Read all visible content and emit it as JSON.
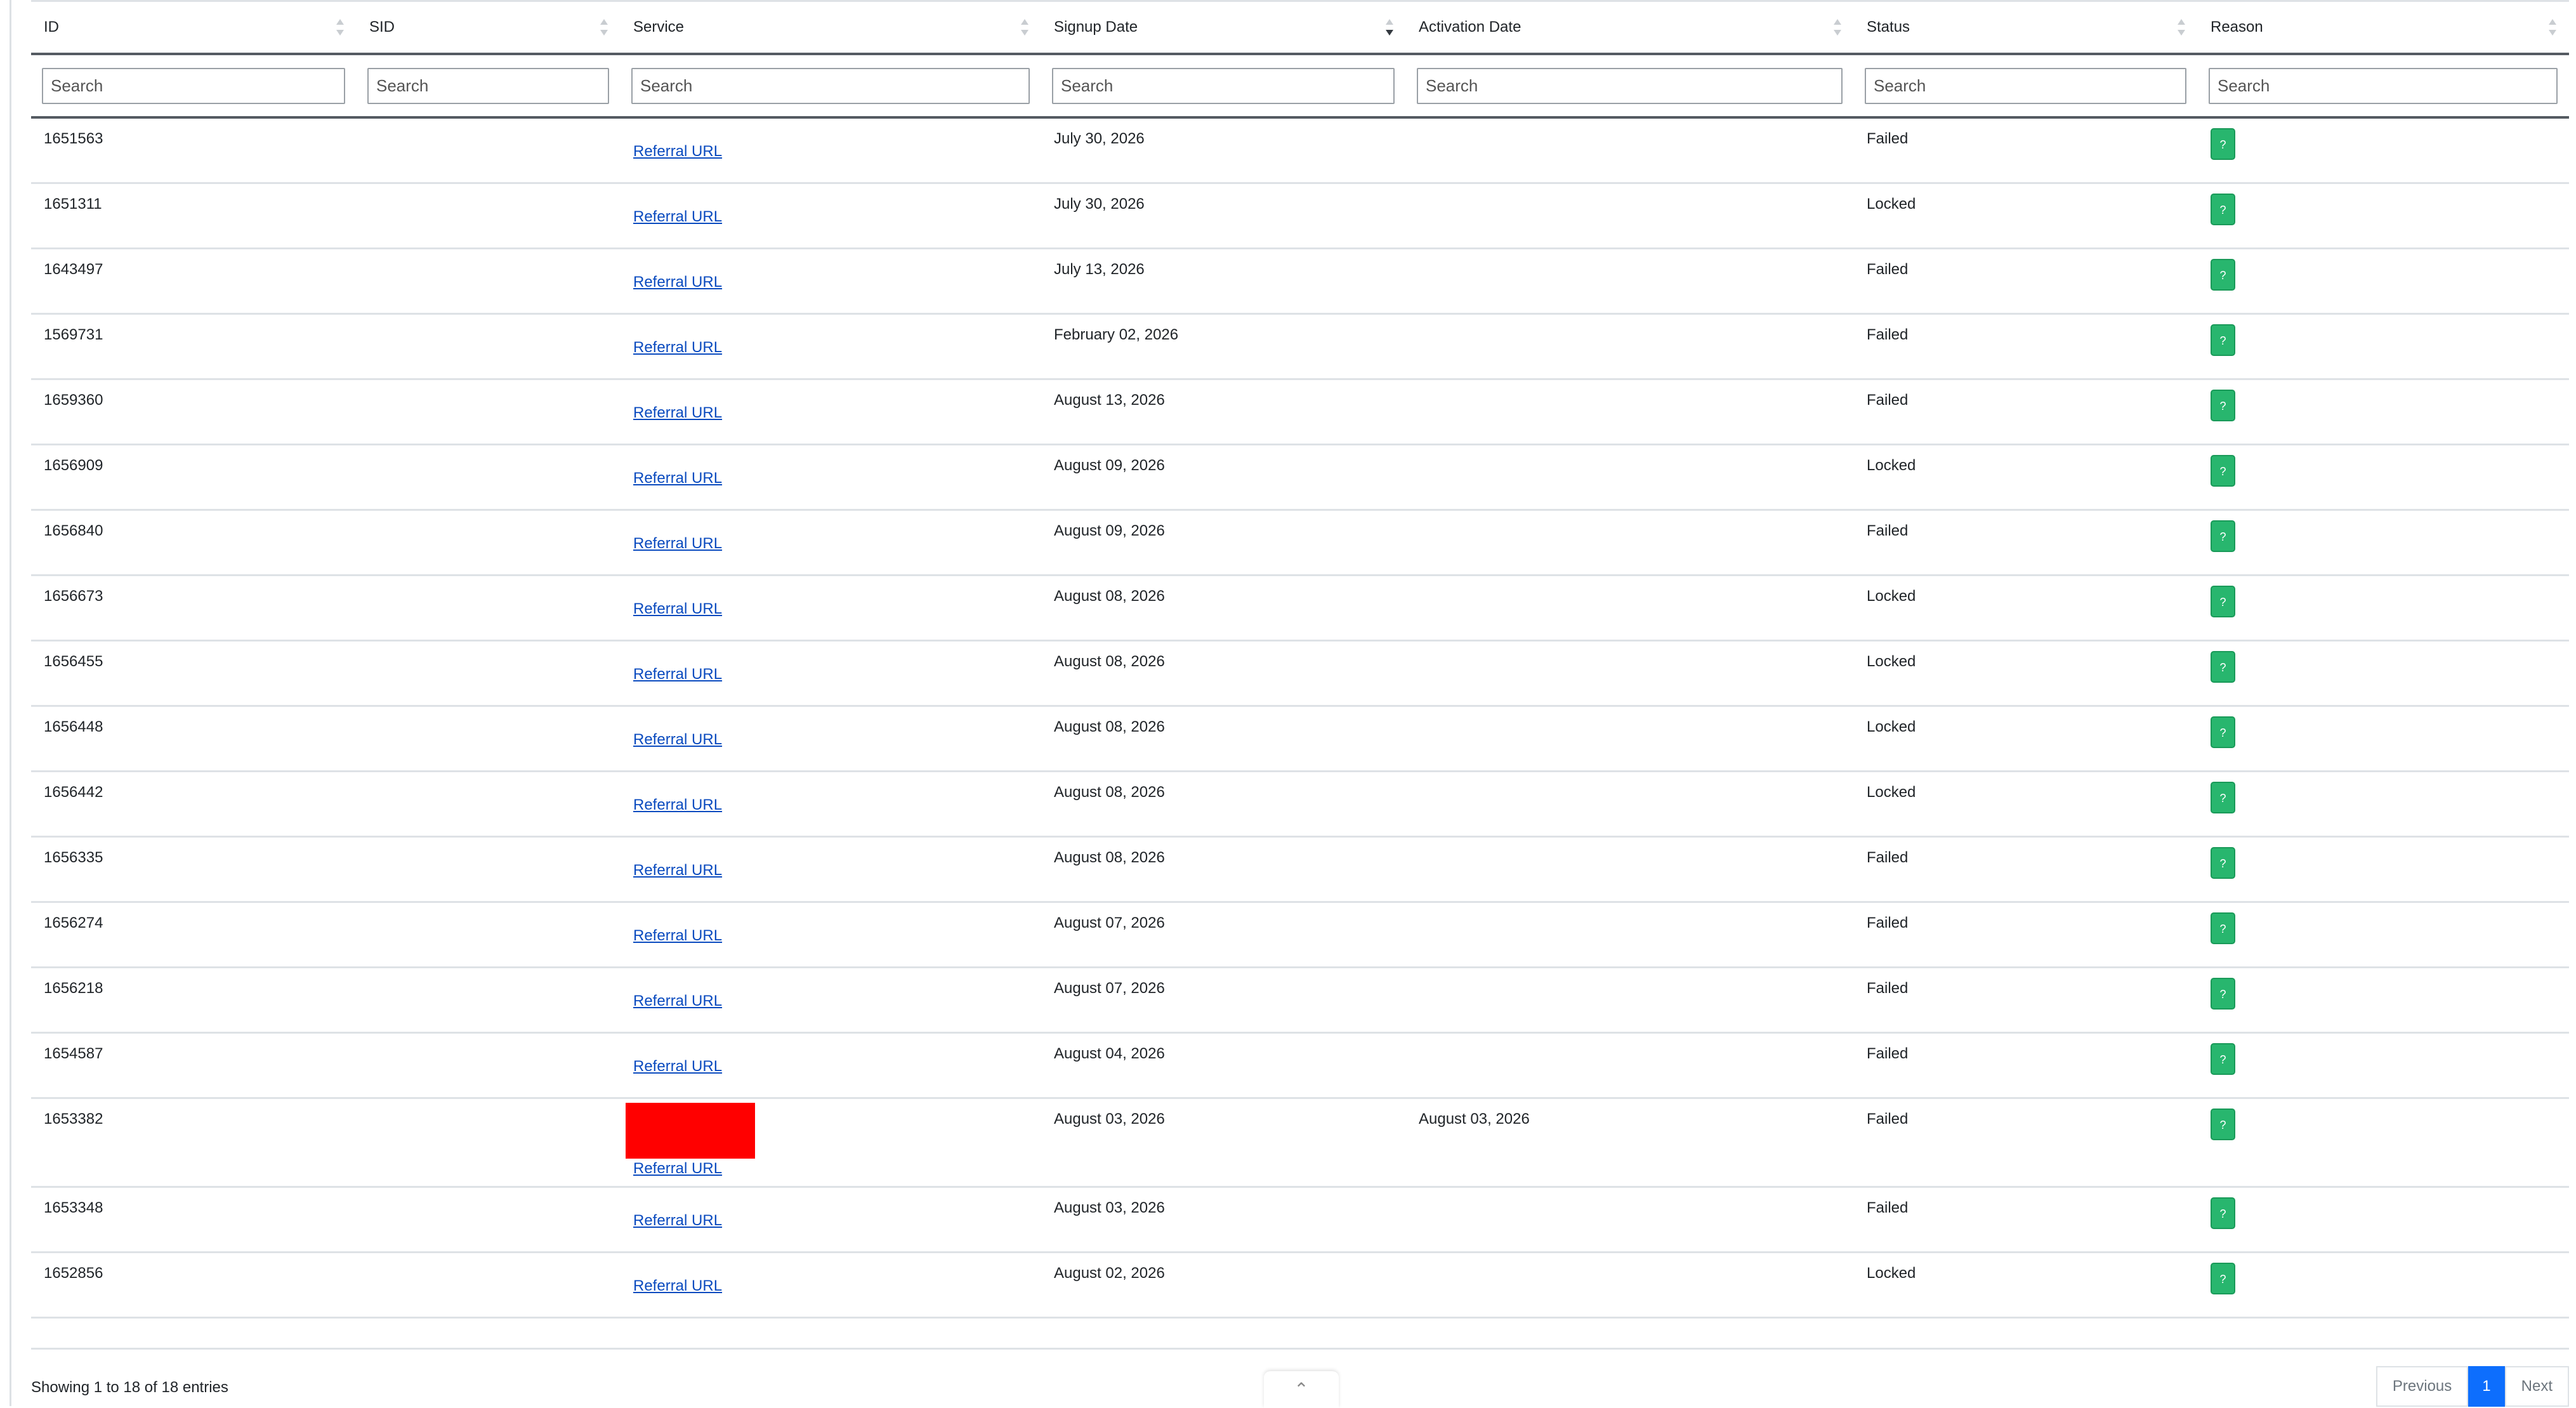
{
  "table": {
    "columns": [
      "ID",
      "SID",
      "Service",
      "Signup Date",
      "Activation Date",
      "Status",
      "Reason"
    ],
    "sorted_column": "Signup Date",
    "filter_placeholder": "Search",
    "rows": [
      {
        "id": "1651563",
        "sid": "",
        "service_link": "Referral URL",
        "signup": "July 30, 2026",
        "activation": "",
        "status": "Failed",
        "reason": "?"
      },
      {
        "id": "1651311",
        "sid": "",
        "service_link": "Referral URL",
        "signup": "July 30, 2026",
        "activation": "",
        "status": "Locked",
        "reason": "?"
      },
      {
        "id": "1643497",
        "sid": "",
        "service_link": "Referral URL",
        "signup": "July 13, 2026",
        "activation": "",
        "status": "Failed",
        "reason": "?"
      },
      {
        "id": "1569731",
        "sid": "",
        "service_link": "Referral URL",
        "signup": "February 02, 2026",
        "activation": "",
        "status": "Failed",
        "reason": "?"
      },
      {
        "id": "1659360",
        "sid": "",
        "service_link": "Referral URL",
        "signup": "August 13, 2026",
        "activation": "",
        "status": "Failed",
        "reason": "?"
      },
      {
        "id": "1656909",
        "sid": "",
        "service_link": "Referral URL",
        "signup": "August 09, 2026",
        "activation": "",
        "status": "Locked",
        "reason": "?"
      },
      {
        "id": "1656840",
        "sid": "",
        "service_link": "Referral URL",
        "signup": "August 09, 2026",
        "activation": "",
        "status": "Failed",
        "reason": "?"
      },
      {
        "id": "1656673",
        "sid": "",
        "service_link": "Referral URL",
        "signup": "August 08, 2026",
        "activation": "",
        "status": "Locked",
        "reason": "?"
      },
      {
        "id": "1656455",
        "sid": "",
        "service_link": "Referral URL",
        "signup": "August 08, 2026",
        "activation": "",
        "status": "Locked",
        "reason": "?"
      },
      {
        "id": "1656448",
        "sid": "",
        "service_link": "Referral URL",
        "signup": "August 08, 2026",
        "activation": "",
        "status": "Locked",
        "reason": "?"
      },
      {
        "id": "1656442",
        "sid": "",
        "service_link": "Referral URL",
        "signup": "August 08, 2026",
        "activation": "",
        "status": "Locked",
        "reason": "?"
      },
      {
        "id": "1656335",
        "sid": "",
        "service_link": "Referral URL",
        "signup": "August 08, 2026",
        "activation": "",
        "status": "Failed",
        "reason": "?"
      },
      {
        "id": "1656274",
        "sid": "",
        "service_link": "Referral URL",
        "signup": "August 07, 2026",
        "activation": "",
        "status": "Failed",
        "reason": "?"
      },
      {
        "id": "1656218",
        "sid": "",
        "service_link": "Referral URL",
        "signup": "August 07, 2026",
        "activation": "",
        "status": "Failed",
        "reason": "?"
      },
      {
        "id": "1654587",
        "sid": "",
        "service_link": "Referral URL",
        "signup": "August 04, 2026",
        "activation": "",
        "status": "Failed",
        "reason": "?"
      },
      {
        "id": "1653382",
        "sid": "",
        "service_link": "Referral URL",
        "signup": "August 03, 2026",
        "activation": "August 03, 2026",
        "status": "Failed",
        "reason": "?",
        "redacted": true
      },
      {
        "id": "1653348",
        "sid": "",
        "service_link": "Referral URL",
        "signup": "August 03, 2026",
        "activation": "",
        "status": "Failed",
        "reason": "?"
      },
      {
        "id": "1652856",
        "sid": "",
        "service_link": "Referral URL",
        "signup": "August 02, 2026",
        "activation": "",
        "status": "Locked",
        "reason": "?"
      }
    ]
  },
  "footer": {
    "info": "Showing 1 to 18 of 18 entries",
    "scroll_top_icon": "chevron-up-icon",
    "scroll_top_glyph": "⌃",
    "previous_label": "Previous",
    "current_page": "1",
    "next_label": "Next"
  },
  "colors": {
    "reason_button": "#28b66e",
    "link": "#0b4bbf",
    "pager_active": "#0d6efd",
    "redaction": "#ff0000"
  }
}
